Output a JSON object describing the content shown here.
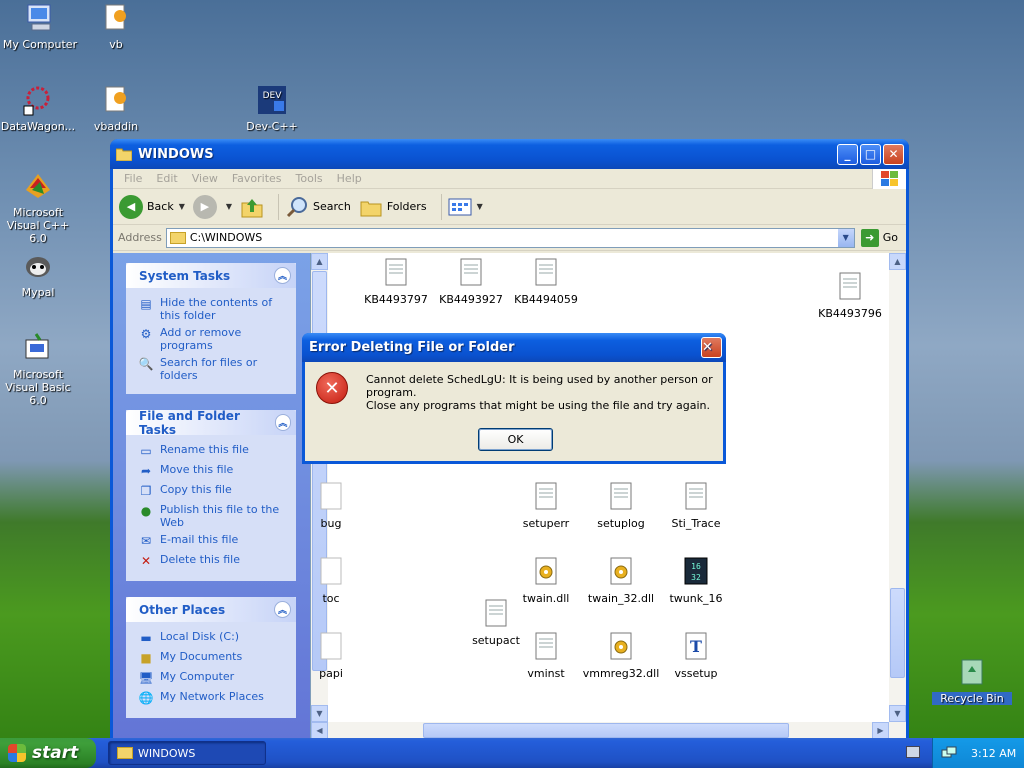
{
  "desktop": {
    "icons": [
      {
        "label": "My Computer",
        "icon": "my-computer-icon"
      },
      {
        "label": "vb",
        "icon": "vb-folder-icon"
      },
      {
        "label": "DataWagon...",
        "icon": "datawagon-shortcut-icon"
      },
      {
        "label": "vbaddin",
        "icon": "vbaddin-icon"
      },
      {
        "label": "Dev-C++",
        "icon": "devcpp-shortcut-icon"
      },
      {
        "label": "Microsoft Visual C++ 6.0",
        "icon": "visual-cpp-icon"
      },
      {
        "label": "Mypal",
        "icon": "mypal-icon"
      },
      {
        "label": "Microsoft Visual Basic 6.0",
        "icon": "visual-basic-icon"
      },
      {
        "label": "Recycle Bin",
        "icon": "recycle-bin-icon"
      }
    ]
  },
  "window": {
    "title": "WINDOWS",
    "menu": [
      "File",
      "Edit",
      "View",
      "Favorites",
      "Tools",
      "Help"
    ],
    "toolbar": {
      "back": "Back",
      "search": "Search",
      "folders": "Folders"
    },
    "address": {
      "label": "Address",
      "value": "C:\\WINDOWS",
      "go": "Go"
    }
  },
  "tasks": {
    "system": {
      "title": "System Tasks",
      "items": [
        "Hide the contents of this folder",
        "Add or remove programs",
        "Search for files or folders"
      ]
    },
    "file_folder": {
      "title": "File and Folder Tasks",
      "items": [
        "Rename this file",
        "Move this file",
        "Copy this file",
        "Publish this file to the Web",
        "E-mail this file",
        "Delete this file"
      ]
    },
    "other": {
      "title": "Other Places",
      "items": [
        "Local Disk (C:)",
        "My Documents",
        "My Computer",
        "My Network Places"
      ]
    }
  },
  "files": [
    {
      "name": "KB4493797"
    },
    {
      "name": "KB4493927"
    },
    {
      "name": "KB4494059"
    },
    {
      "name": "KB4493796"
    },
    {
      "name": "bug"
    },
    {
      "name": "setuperr"
    },
    {
      "name": "setuplog"
    },
    {
      "name": "Sti_Trace"
    },
    {
      "name": "toc"
    },
    {
      "name": "twain.dll"
    },
    {
      "name": "twain_32.dll"
    },
    {
      "name": "twunk_16"
    },
    {
      "name": "setupact"
    },
    {
      "name": "papi"
    },
    {
      "name": "vminst"
    },
    {
      "name": "vmmreg32.dll"
    },
    {
      "name": "vssetup"
    }
  ],
  "dialog": {
    "title": "Error Deleting File or Folder",
    "message": "Cannot delete SchedLgU: It is being used by another person or program.",
    "hint": "Close any programs that might be using the file and try again.",
    "ok": "OK"
  },
  "taskbar": {
    "start": "start",
    "task_window": "WINDOWS",
    "clock": "3:12 AM"
  },
  "colors": {
    "accent": "#0a58d8",
    "start_green": "#3c9c3c",
    "task_link": "#215dc6",
    "error_red": "#c41c10"
  }
}
